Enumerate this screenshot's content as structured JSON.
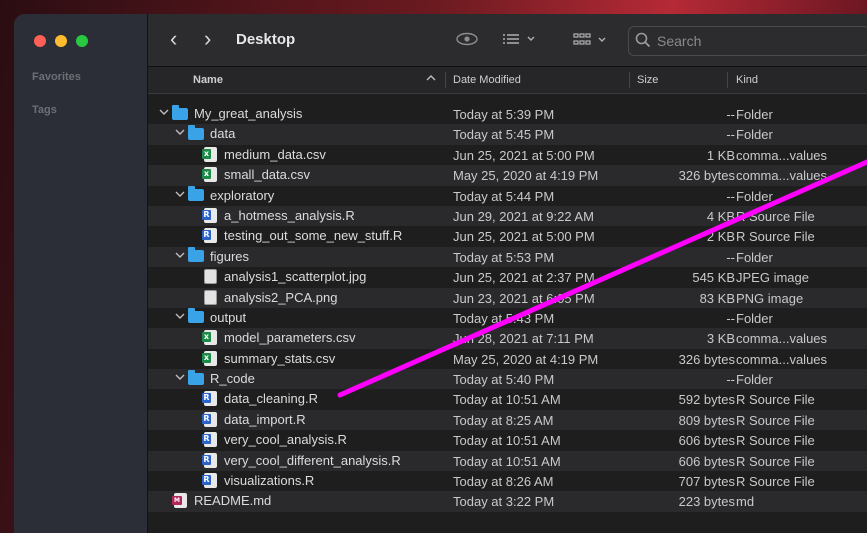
{
  "window": {
    "title": "Desktop"
  },
  "sidebar": {
    "favorites_label": "Favorites",
    "tags_label": "Tags"
  },
  "toolbar": {
    "back_glyph": "‹",
    "forward_glyph": "›",
    "search_placeholder": "Search"
  },
  "columns": {
    "name": "Name",
    "date_modified": "Date Modified",
    "size": "Size",
    "kind": "Kind"
  },
  "files": [
    {
      "name": "My_great_analysis",
      "modified": "Today at 5:39 PM",
      "size": "--",
      "kind": "Folder",
      "type": "folder",
      "level": 0,
      "expanded": true
    },
    {
      "name": "data",
      "modified": "Today at 5:45 PM",
      "size": "--",
      "kind": "Folder",
      "type": "folder",
      "level": 1,
      "expanded": true
    },
    {
      "name": "medium_data.csv",
      "modified": "Jun 25, 2021 at 5:00 PM",
      "size": "1 KB",
      "kind": "comma...values",
      "type": "csv",
      "level": 2
    },
    {
      "name": "small_data.csv",
      "modified": "May 25, 2020 at 4:19 PM",
      "size": "326 bytes",
      "kind": "comma...values",
      "type": "csv",
      "level": 2
    },
    {
      "name": "exploratory",
      "modified": "Today at 5:44 PM",
      "size": "--",
      "kind": "Folder",
      "type": "folder",
      "level": 1,
      "expanded": true
    },
    {
      "name": "a_hotmess_analysis.R",
      "modified": "Jun 29, 2021 at 9:22 AM",
      "size": "4 KB",
      "kind": "R Source File",
      "type": "r",
      "level": 2
    },
    {
      "name": "testing_out_some_new_stuff.R",
      "modified": "Jun 25, 2021 at 5:00 PM",
      "size": "2 KB",
      "kind": "R Source File",
      "type": "r",
      "level": 2
    },
    {
      "name": "figures",
      "modified": "Today at 5:53 PM",
      "size": "--",
      "kind": "Folder",
      "type": "folder",
      "level": 1,
      "expanded": true
    },
    {
      "name": "analysis1_scatterplot.jpg",
      "modified": "Jun 25, 2021 at 2:37 PM",
      "size": "545 KB",
      "kind": "JPEG image",
      "type": "img",
      "level": 2
    },
    {
      "name": "analysis2_PCA.png",
      "modified": "Jun 23, 2021 at 6:05 PM",
      "size": "83 KB",
      "kind": "PNG image",
      "type": "img",
      "level": 2
    },
    {
      "name": "output",
      "modified": "Today at 5:43 PM",
      "size": "--",
      "kind": "Folder",
      "type": "folder",
      "level": 1,
      "expanded": true
    },
    {
      "name": "model_parameters.csv",
      "modified": "Jun 28, 2021 at 7:11 PM",
      "size": "3 KB",
      "kind": "comma...values",
      "type": "csv",
      "level": 2
    },
    {
      "name": "summary_stats.csv",
      "modified": "May 25, 2020 at 4:19 PM",
      "size": "326 bytes",
      "kind": "comma...values",
      "type": "csv",
      "level": 2
    },
    {
      "name": "R_code",
      "modified": "Today at 5:40 PM",
      "size": "--",
      "kind": "Folder",
      "type": "folder",
      "level": 1,
      "expanded": true
    },
    {
      "name": "data_cleaning.R",
      "modified": "Today at 10:51 AM",
      "size": "592 bytes",
      "kind": "R Source File",
      "type": "r",
      "level": 2
    },
    {
      "name": "data_import.R",
      "modified": "Today at 8:25 AM",
      "size": "809 bytes",
      "kind": "R Source File",
      "type": "r",
      "level": 2
    },
    {
      "name": "very_cool_analysis.R",
      "modified": "Today at 10:51 AM",
      "size": "606 bytes",
      "kind": "R Source File",
      "type": "r",
      "level": 2
    },
    {
      "name": "very_cool_different_analysis.R",
      "modified": "Today at 10:51 AM",
      "size": "606 bytes",
      "kind": "R Source File",
      "type": "r",
      "level": 2
    },
    {
      "name": "visualizations.R",
      "modified": "Today at 8:26 AM",
      "size": "707 bytes",
      "kind": "R Source File",
      "type": "r",
      "level": 2
    },
    {
      "name": "README.md",
      "modified": "Today at 3:22 PM",
      "size": "223 bytes",
      "kind": "md",
      "type": "md",
      "level": 1
    }
  ],
  "annotation": {
    "line_color": "#ff00ff"
  },
  "colors": {
    "folder": "#3aa2e6",
    "window_bg": "#1e1e1e",
    "sidebar_bg": "#2b2e36"
  }
}
